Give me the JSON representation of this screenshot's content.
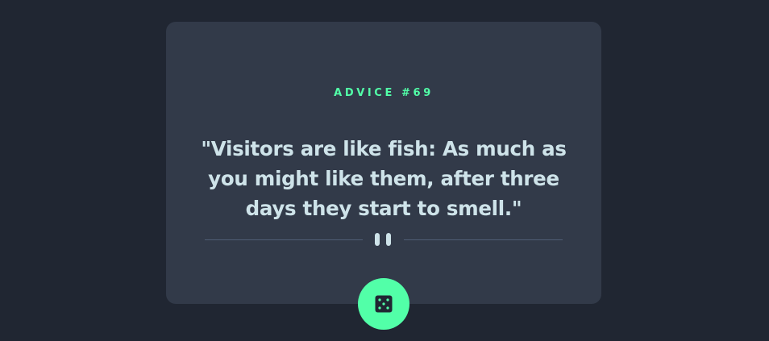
{
  "advice": {
    "label": "ADVICE #69",
    "quote": "\"Visitors are like fish: As much as you might like them, after three days they start to smell.\""
  },
  "divider": {
    "icon": "pause-icon"
  },
  "button": {
    "icon": "dice-icon",
    "color": "#52ffa8"
  },
  "colors": {
    "background": "#202632",
    "card": "#323a49",
    "accent": "#52ffa8",
    "text": "#cee3e9",
    "divider_line": "#4f5d74"
  }
}
